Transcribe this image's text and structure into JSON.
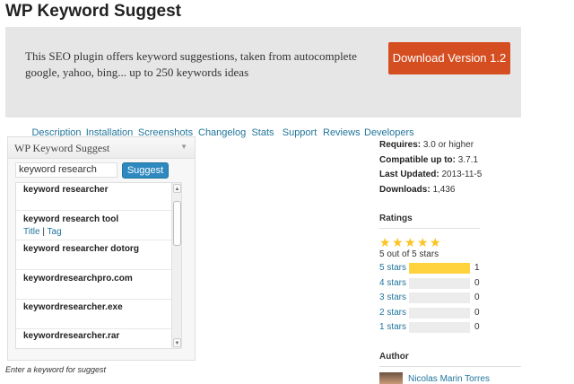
{
  "page_title": "WP Keyword Suggest",
  "banner": {
    "description": "This SEO plugin offers keyword suggestions, taken from autocomplete google, yahoo, bing... up to 250 keywords ideas",
    "download_label": "Download Version 1.2",
    "accent_color": "#d54e21"
  },
  "tabs": [
    {
      "label": "Description",
      "active": false
    },
    {
      "label": "Installation",
      "active": false
    },
    {
      "label": "Screenshots",
      "active": true
    },
    {
      "label": "Changelog",
      "active": false
    },
    {
      "label": "Stats",
      "active": false
    },
    {
      "label": "Support",
      "active": false
    },
    {
      "label": "Reviews",
      "active": false
    },
    {
      "label": "Developers",
      "active": false
    }
  ],
  "widget": {
    "title": "WP Keyword Suggest",
    "collapse_icon": "triangle-down-icon",
    "input_value": "keyword research",
    "suggest_label": "Suggest",
    "results": [
      {
        "term": "keyword researcher",
        "links": null
      },
      {
        "term": "keyword research tool",
        "links": {
          "title": "Title",
          "sep": "|",
          "tag": "Tag"
        }
      },
      {
        "term": "keyword researcher dotorg",
        "links": null
      },
      {
        "term": "keywordresearchpro.com",
        "links": null
      },
      {
        "term": "keywordresearcher.exe",
        "links": null
      },
      {
        "term": "keywordresearcher.rar",
        "links": null
      }
    ],
    "caption": "Enter a keyword for suggest"
  },
  "meta": {
    "requires_label": "Requires:",
    "requires_value": "3.0 or higher",
    "compatible_label": "Compatible up to:",
    "compatible_value": "3.7.1",
    "updated_label": "Last Updated:",
    "updated_value": "2013-11-5",
    "downloads_label": "Downloads:",
    "downloads_value": "1,436"
  },
  "ratings": {
    "heading": "Ratings",
    "stars_filled": 5,
    "summary": "5 out of 5 stars",
    "rows": [
      {
        "label": "5 stars",
        "count": "1",
        "fraction": 1.0
      },
      {
        "label": "4 stars",
        "count": "0",
        "fraction": 0
      },
      {
        "label": "3 stars",
        "count": "0",
        "fraction": 0
      },
      {
        "label": "2 stars",
        "count": "0",
        "fraction": 0
      },
      {
        "label": "1 stars",
        "count": "0",
        "fraction": 0
      }
    ]
  },
  "author": {
    "heading": "Author",
    "name": "Nicolas Marin Torres"
  }
}
